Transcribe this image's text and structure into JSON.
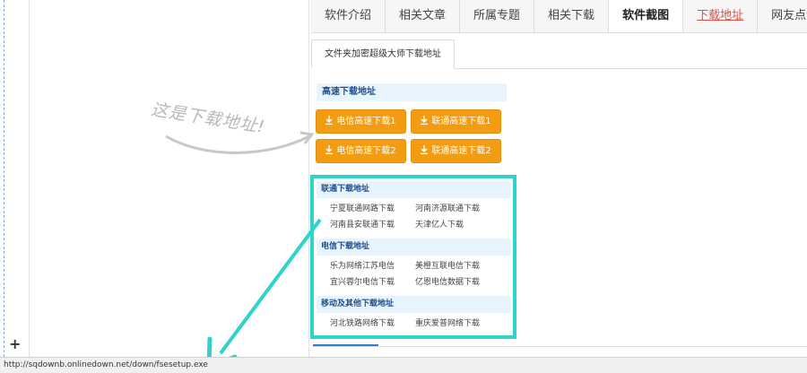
{
  "tabs": [
    {
      "label": "软件介绍"
    },
    {
      "label": "相关文章"
    },
    {
      "label": "所属专题"
    },
    {
      "label": "相关下载"
    },
    {
      "label": "软件截图"
    },
    {
      "label": "下载地址"
    },
    {
      "label": "网友点评"
    }
  ],
  "subtab": {
    "label": "文件夹加密超级大师下载地址"
  },
  "fast_download": {
    "heading": "高速下载地址",
    "buttons": [
      {
        "label": "电信高速下载1"
      },
      {
        "label": "联通高速下载1"
      },
      {
        "label": "电信高速下载2"
      },
      {
        "label": "联通高速下载2"
      }
    ]
  },
  "groups": [
    {
      "heading": "联通下载地址",
      "links": [
        "宁夏联通网路下载",
        "河南济源联通下载",
        "河南县安联通下载",
        "天津亿人下载"
      ]
    },
    {
      "heading": "电信下载地址",
      "links": [
        "乐为网络江苏电信",
        "美橙互联电信下载",
        "宜兴蓉尔电信下载",
        "亿恩电信数据下载"
      ]
    },
    {
      "heading": "移动及其他下载地址",
      "links": [
        "河北铁路网络下载",
        "重庆爱普网络下载"
      ]
    }
  ],
  "annotation": "这是下载地址!",
  "left_panel": {
    "plus": "+"
  },
  "status_bar": {
    "url": "http://sqdownb.onlinedown.net/down/fsesetup.exe"
  },
  "colors": {
    "accent_orange": "#f39c12",
    "highlight_teal": "#2dd4c9",
    "link_red": "#d9534f"
  }
}
